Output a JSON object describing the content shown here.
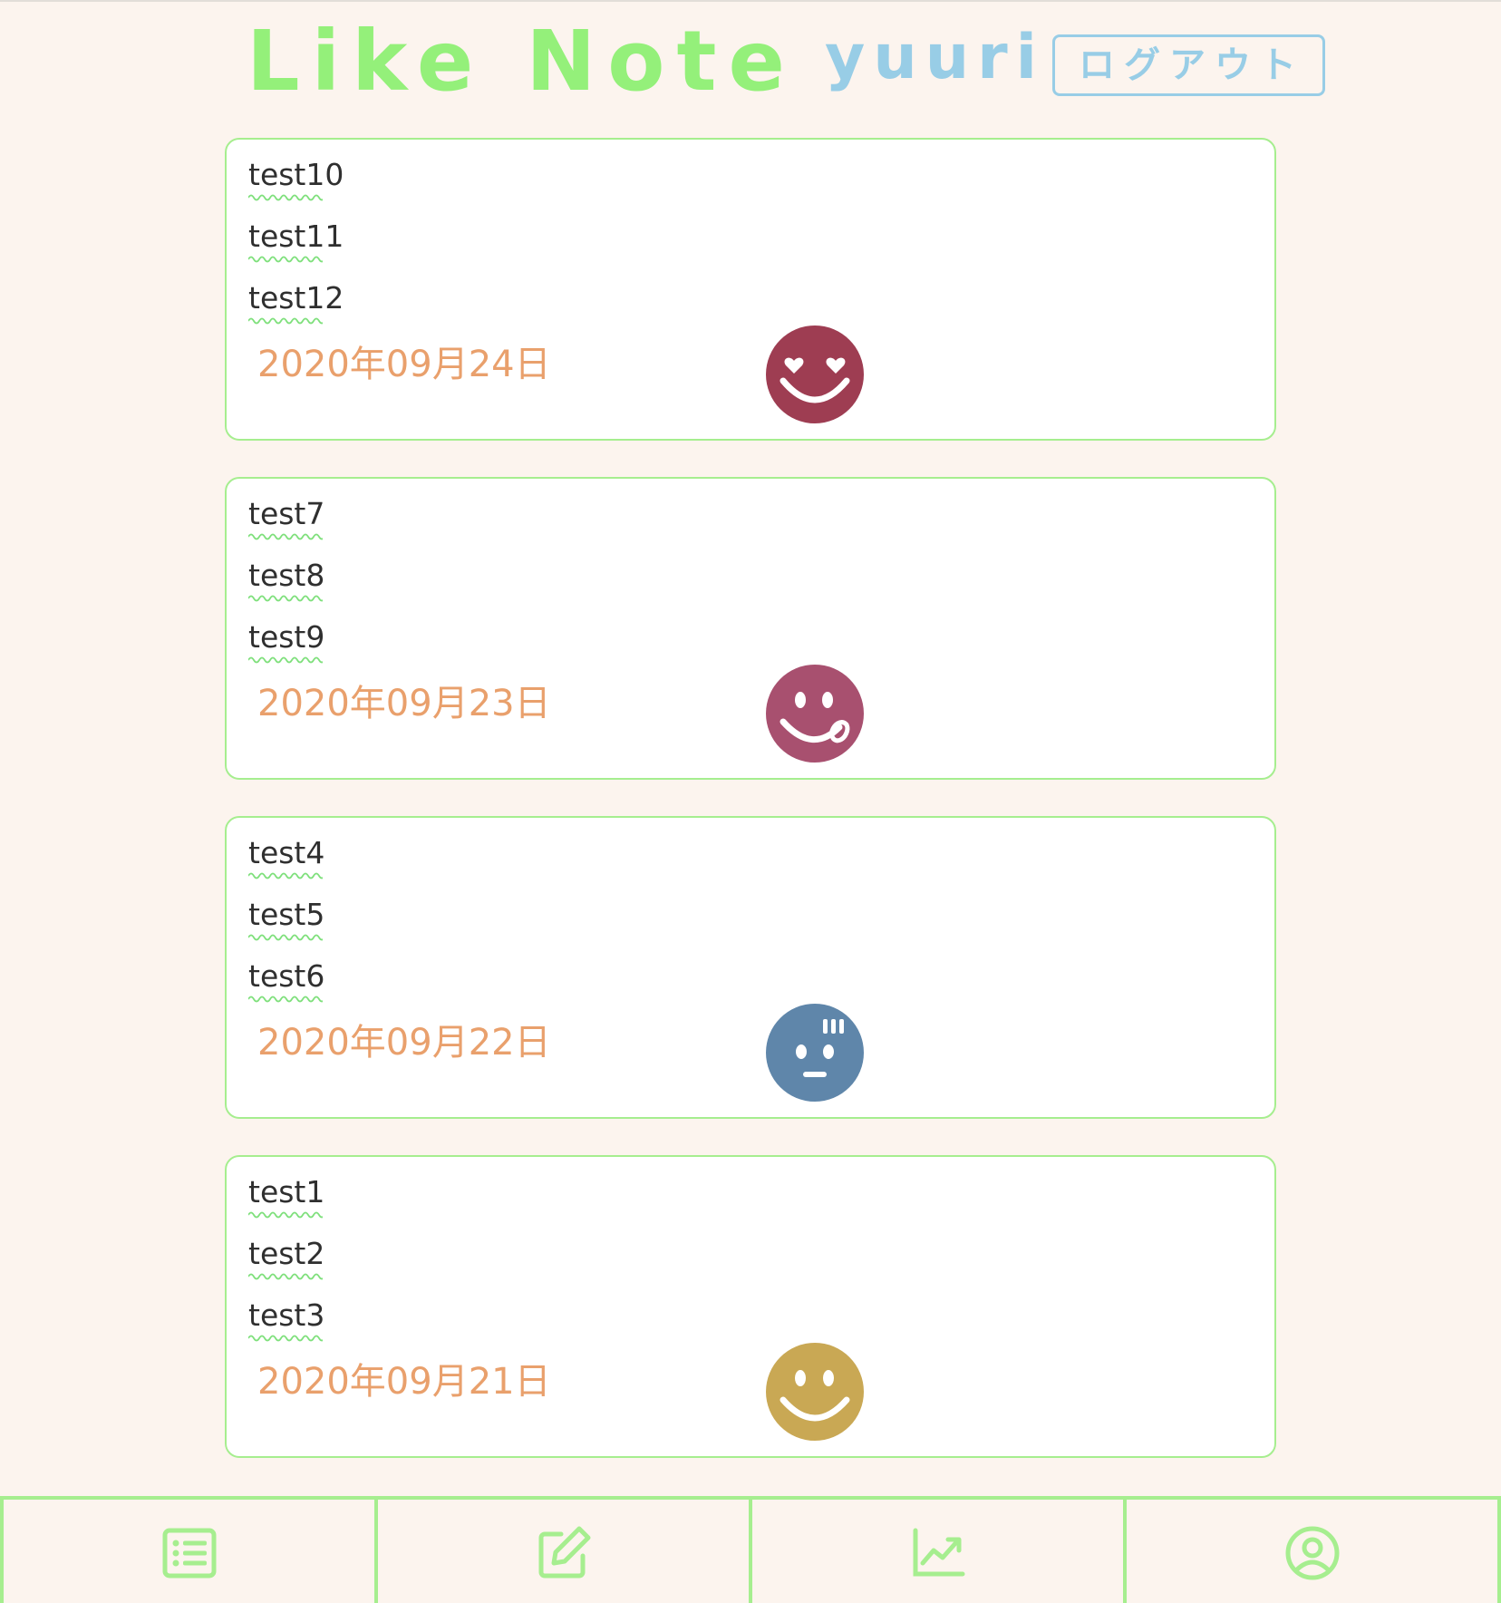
{
  "header": {
    "app_title": "Like Note",
    "username": "yuuri",
    "logout_label": "ログアウト",
    "title_color": "#94f07a",
    "accent_color": "#98cde6"
  },
  "notes": [
    {
      "items": [
        "test10",
        "test11",
        "test12"
      ],
      "date": "2020年09月24日",
      "mood_icon": "heart-eyes-face-icon",
      "mood_color": "#9e3d52"
    },
    {
      "items": [
        "test7",
        "test8",
        "test9"
      ],
      "date": "2020年09月23日",
      "mood_icon": "tongue-out-face-icon",
      "mood_color": "#a8506f"
    },
    {
      "items": [
        "test4",
        "test5",
        "test6"
      ],
      "date": "2020年09月22日",
      "mood_icon": "worried-face-icon",
      "mood_color": "#5f86aa"
    },
    {
      "items": [
        "test1",
        "test2",
        "test3"
      ],
      "date": "2020年09月21日",
      "mood_icon": "smile-face-icon",
      "mood_color": "#c9a854"
    }
  ],
  "bottom_nav": [
    {
      "icon": "list-icon"
    },
    {
      "icon": "edit-icon"
    },
    {
      "icon": "chart-icon"
    },
    {
      "icon": "user-icon"
    }
  ],
  "colors": {
    "background": "#fcf4ee",
    "card_border": "#a6ee8f",
    "date_text": "#e9a06c"
  }
}
